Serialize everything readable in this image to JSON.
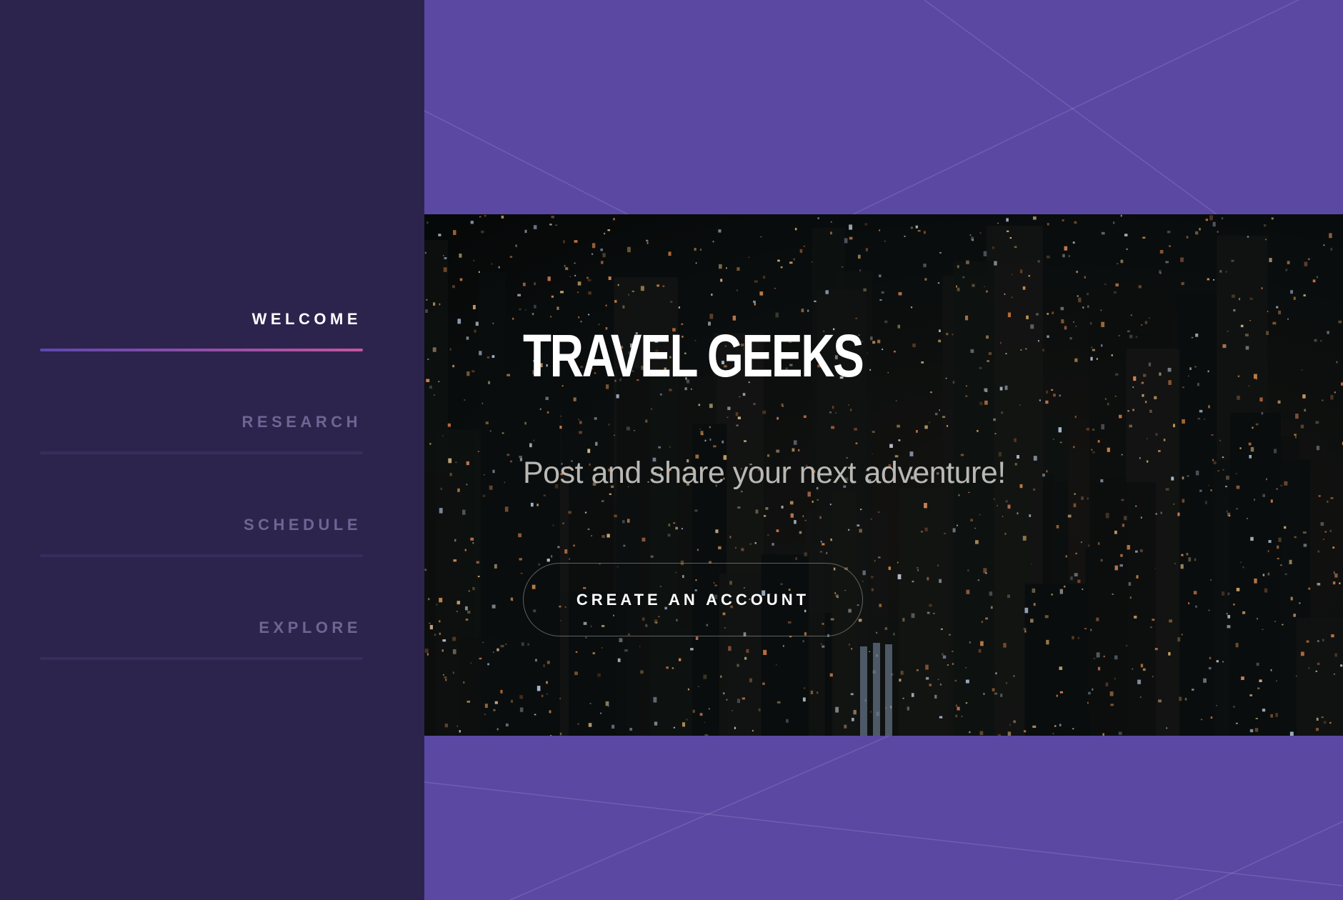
{
  "sidebar": {
    "items": [
      {
        "label": "WELCOME",
        "active": true
      },
      {
        "label": "RESEARCH",
        "active": false
      },
      {
        "label": "SCHEDULE",
        "active": false
      },
      {
        "label": "EXPLORE",
        "active": false
      }
    ]
  },
  "hero": {
    "title": "TRAVEL GEEKS",
    "subtitle": "Post and share your next adventure!",
    "cta_label": "CREATE AN ACCOUNT",
    "background_image": "night city skyline"
  },
  "colors": {
    "sidebar_bg": "#2d244d",
    "main_bg": "#5a48a3",
    "active_underline_start": "#5d47b0",
    "active_underline_end": "#c456a0"
  }
}
